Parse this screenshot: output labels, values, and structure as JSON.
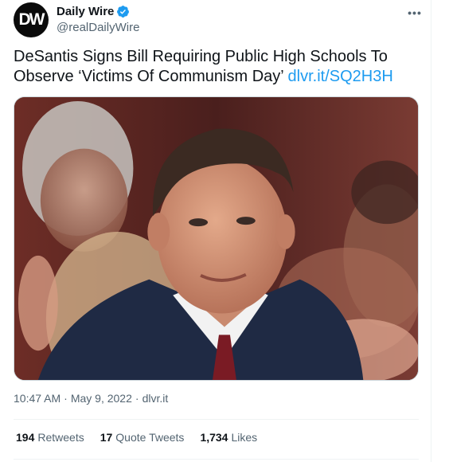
{
  "tweet": {
    "author": {
      "avatar_text": "DW",
      "display_name": "Daily Wire",
      "handle": "@realDailyWire",
      "verified": true
    },
    "more_icon": "more-horizontal-icon",
    "text": "DeSantis Signs Bill Requiring Public High Schools To Observe ‘Victims Of Communism Day’ ",
    "link_text": "dlvr.it/SQ2H3H",
    "time": "10:47 AM",
    "date": "May 9, 2022",
    "source": "dlvr.it",
    "separator": "·",
    "stats": {
      "retweets_count": "194",
      "retweets_label": "Retweets",
      "quotes_count": "17",
      "quotes_label": "Quote Tweets",
      "likes_count": "1,734",
      "likes_label": "Likes"
    },
    "colors": {
      "link": "#1d9bf0",
      "verified": "#1d9bf0",
      "text": "#0f1419",
      "muted": "#536471"
    }
  }
}
